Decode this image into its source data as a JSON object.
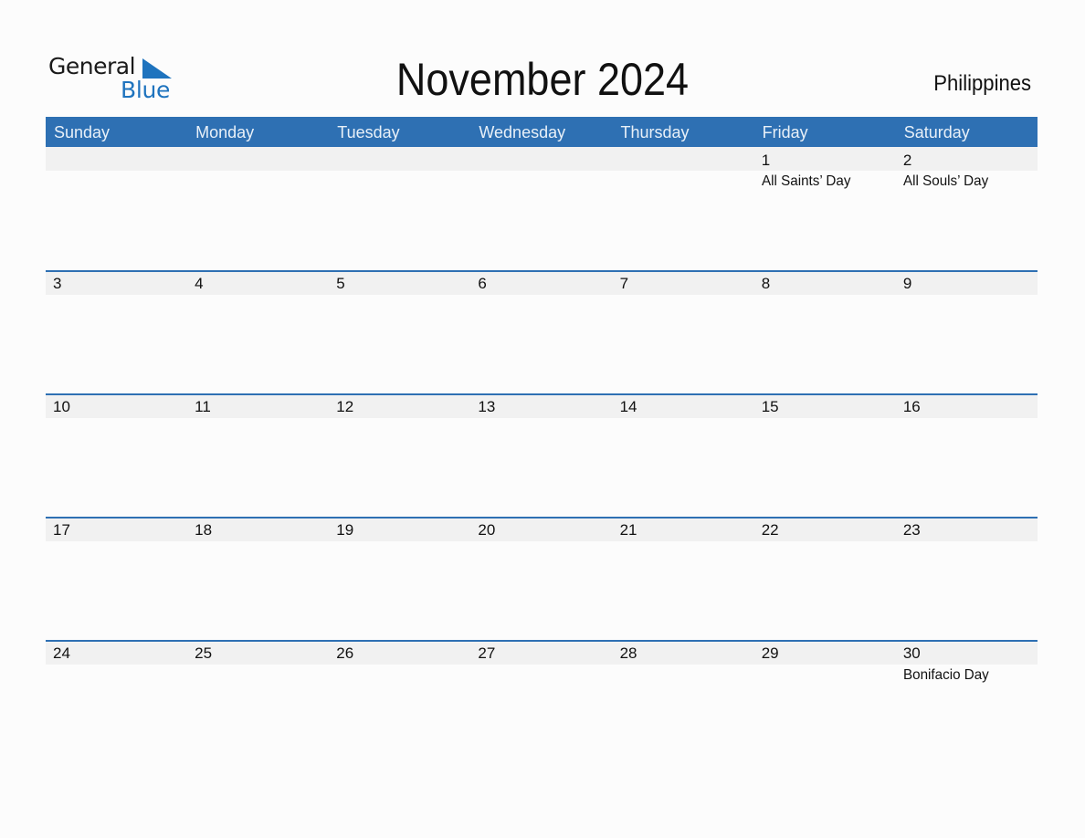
{
  "logo": {
    "line1": "General",
    "line2": "Blue"
  },
  "title": "November 2024",
  "country": "Philippines",
  "colors": {
    "accent": "#2e70b3",
    "band": "#f1f1f1",
    "logo_blue": "#1e73be"
  },
  "weekdays": [
    "Sunday",
    "Monday",
    "Tuesday",
    "Wednesday",
    "Thursday",
    "Friday",
    "Saturday"
  ],
  "weeks": [
    [
      {
        "day": ""
      },
      {
        "day": ""
      },
      {
        "day": ""
      },
      {
        "day": ""
      },
      {
        "day": ""
      },
      {
        "day": "1",
        "holiday": "All Saints’ Day"
      },
      {
        "day": "2",
        "holiday": "All Souls’ Day"
      }
    ],
    [
      {
        "day": "3"
      },
      {
        "day": "4"
      },
      {
        "day": "5"
      },
      {
        "day": "6"
      },
      {
        "day": "7"
      },
      {
        "day": "8"
      },
      {
        "day": "9"
      }
    ],
    [
      {
        "day": "10"
      },
      {
        "day": "11"
      },
      {
        "day": "12"
      },
      {
        "day": "13"
      },
      {
        "day": "14"
      },
      {
        "day": "15"
      },
      {
        "day": "16"
      }
    ],
    [
      {
        "day": "17"
      },
      {
        "day": "18"
      },
      {
        "day": "19"
      },
      {
        "day": "20"
      },
      {
        "day": "21"
      },
      {
        "day": "22"
      },
      {
        "day": "23"
      }
    ],
    [
      {
        "day": "24"
      },
      {
        "day": "25"
      },
      {
        "day": "26"
      },
      {
        "day": "27"
      },
      {
        "day": "28"
      },
      {
        "day": "29"
      },
      {
        "day": "30",
        "holiday": "Bonifacio Day"
      }
    ]
  ]
}
